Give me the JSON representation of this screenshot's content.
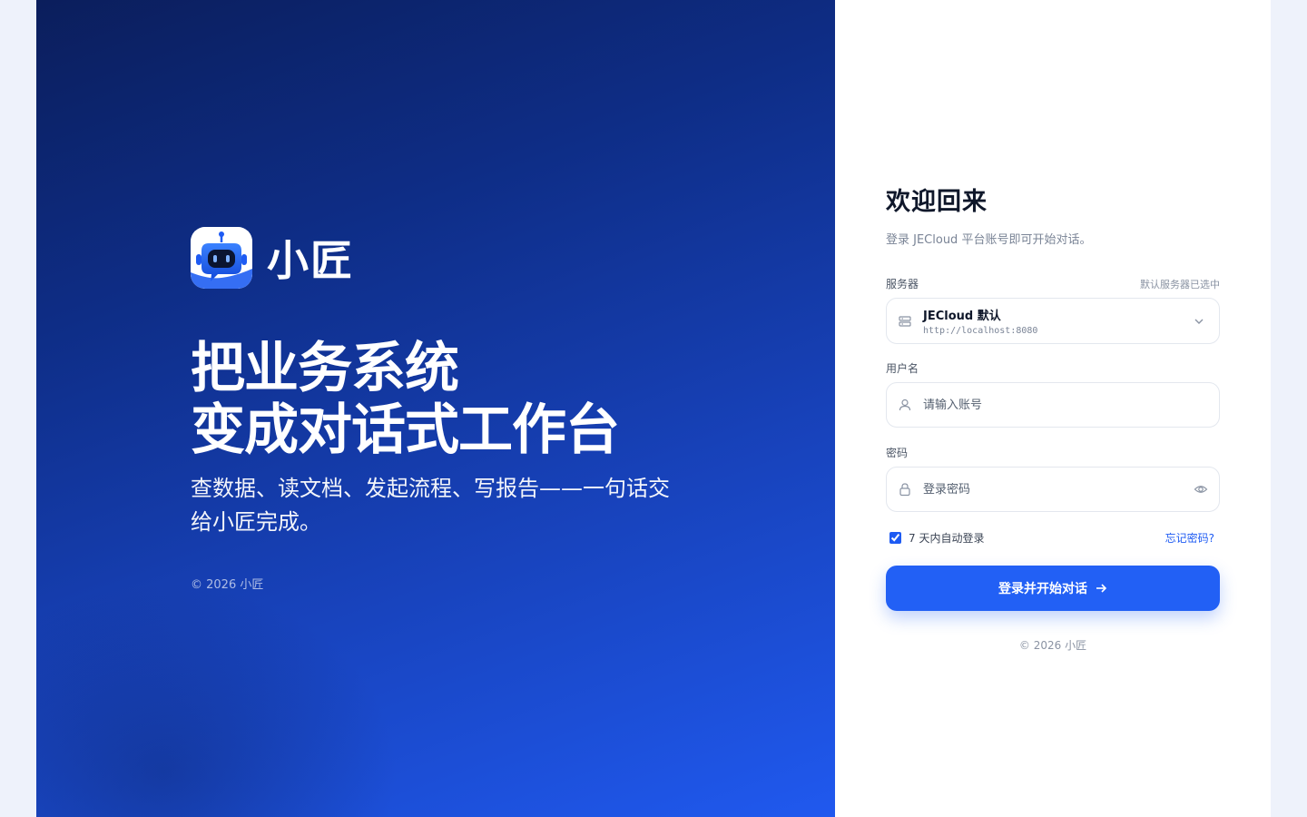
{
  "hero": {
    "brand_name": "小匠",
    "headline_line1": "把业务系统",
    "headline_line2": "变成对话式工作台",
    "subline": "查数据、读文档、发起流程、写报告——一句话交给小匠完成。",
    "copyright": "© 2026 小匠"
  },
  "login": {
    "title": "欢迎回来",
    "subtitle": "登录 JECloud 平台账号即可开始对话。",
    "server": {
      "label": "服务器",
      "hint": "默认服务器已选中",
      "name": "JECloud 默认",
      "url": "http://localhost:8080"
    },
    "username": {
      "label": "用户名",
      "placeholder": "请输入账号",
      "value": ""
    },
    "password": {
      "label": "密码",
      "placeholder": "登录密码",
      "value": ""
    },
    "remember": {
      "label": "7 天内自动登录",
      "checked": true
    },
    "forgot_label": "忘记密码?",
    "submit_label": "登录并开始对话",
    "copyright": "© 2026 小匠"
  },
  "colors": {
    "accent": "#2260f5",
    "hero_start": "#0b1e5c",
    "hero_end": "#2059ef"
  },
  "icons": {
    "logo": "robot-chat-logo",
    "server": "server-icon",
    "user": "user-icon",
    "lock": "lock-icon",
    "eye": "eye-icon",
    "chevron": "chevron-down-icon",
    "arrow": "arrow-right-icon"
  }
}
